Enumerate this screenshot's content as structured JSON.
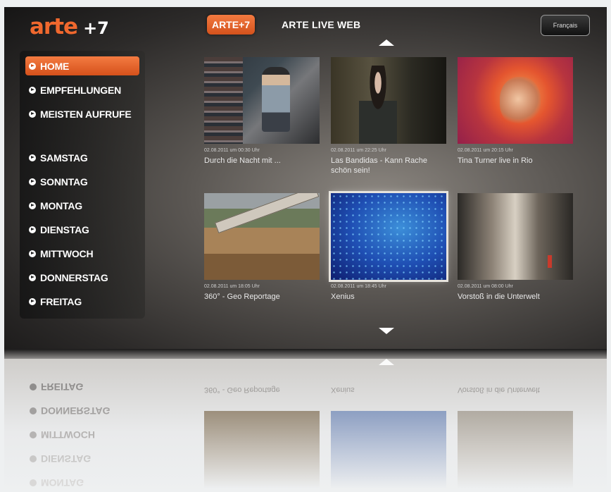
{
  "header": {
    "logo_text": "arte",
    "logo_suffix": "+7",
    "tabs": [
      "ARTE+7",
      "ARTE LIVE WEB"
    ],
    "language_button": "Français"
  },
  "sidebar": {
    "items": [
      {
        "label": "HOME",
        "active": true
      },
      {
        "label": "EMPFEHLUNGEN"
      },
      {
        "label": "MEISTEN AUFRUFE"
      },
      {
        "label": "SAMSTAG"
      },
      {
        "label": "SONNTAG"
      },
      {
        "label": "MONTAG"
      },
      {
        "label": "DIENSTAG"
      },
      {
        "label": "MITTWOCH"
      },
      {
        "label": "DONNERSTAG"
      },
      {
        "label": "FREITAG"
      }
    ]
  },
  "videos": [
    {
      "date": "02.08.2011 um 00:30 Uhr",
      "title": "Durch die Nacht mit ..."
    },
    {
      "date": "02.08.2011 um 22:25 Uhr",
      "title": "Las Bandidas - Kann Rache schön sein!"
    },
    {
      "date": "02.08.2011 um 20:15 Uhr",
      "title": "Tina Turner live in Rio"
    },
    {
      "date": "02.08.2011 um 18:05 Uhr",
      "title": "360° - Geo Reportage"
    },
    {
      "date": "02.08.2011 um 18:45 Uhr",
      "title": "Xenius",
      "selected": true
    },
    {
      "date": "02.08.2011 um 08:00 Uhr",
      "title": "Vorstoß in die Unterwelt"
    }
  ],
  "reflection": {
    "items": [
      "FREITAG",
      "DONNERSTAG",
      "MITTWOCH",
      "DIENSTAG",
      "MONTAG"
    ],
    "titles": [
      "360° - Geo Reportage",
      "Xenius",
      "Vorstoß in die Unterwelt"
    ]
  },
  "colors": {
    "accent": "#e8622a",
    "text": "#ffffff",
    "background": "#2c2a29"
  },
  "icons": [
    "scroll-up-arrow-icon",
    "scroll-down-arrow-icon",
    "menu-bullet-icon"
  ]
}
